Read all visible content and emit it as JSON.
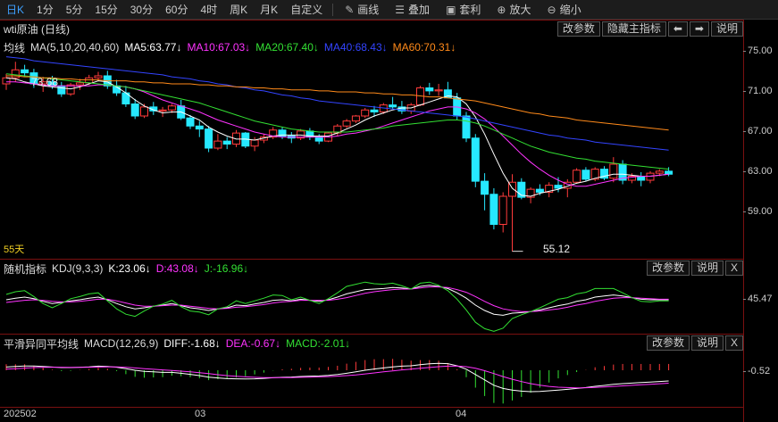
{
  "toolbar": {
    "timeframes": [
      "日K",
      "1分",
      "5分",
      "15分",
      "30分",
      "60分",
      "4时",
      "周K",
      "月K",
      "自定义"
    ],
    "tools": [
      {
        "icon": "pencil-icon",
        "glyph": "✎",
        "label": "画线"
      },
      {
        "icon": "layers-icon",
        "glyph": "☰",
        "label": "叠加"
      },
      {
        "icon": "bag-icon",
        "glyph": "▣",
        "label": "套利"
      },
      {
        "icon": "zoom-in-icon",
        "glyph": "⊕",
        "label": "放大"
      },
      {
        "icon": "zoom-out-icon",
        "glyph": "⊖",
        "label": "缩小"
      }
    ]
  },
  "main": {
    "title": "wti原油 (日线)",
    "buttons": {
      "params": "改参数",
      "hide": "隐藏主指标",
      "left_glyph": "⬅",
      "right_glyph": "➡",
      "help": "说明"
    },
    "ma_name": "均线",
    "ma_params": "MA(5,10,20,40,60)",
    "ma5": "MA5:63.77↓",
    "ma10": "MA10:67.03↓",
    "ma20": "MA20:67.40↓",
    "ma40": "MA40:68.43↓",
    "ma60": "MA60:70.31↓",
    "high_label": "73.68",
    "low_label": "55.12",
    "days_label": "55天",
    "y_ticks": [
      "75.00",
      "71.00",
      "67.00",
      "63.00",
      "59.00"
    ]
  },
  "kdj": {
    "name": "随机指标",
    "params": "KDJ(9,3,3)",
    "k": "K:23.06↓",
    "d": "D:43.08↓",
    "j": "J:-16.96↓",
    "buttons": {
      "params": "改参数",
      "help": "说明",
      "close": "X"
    },
    "y_tick": "45.47"
  },
  "macd": {
    "name": "平滑异同平均线",
    "params": "MACD(12,26,9)",
    "diff": "DIFF:-1.68↓",
    "dea": "DEA:-0.67↓",
    "macd": "MACD:-2.01↓",
    "buttons": {
      "params": "改参数",
      "help": "说明",
      "close": "X"
    },
    "y_tick": "-0.52"
  },
  "x_labels": [
    "202502",
    "03",
    "04"
  ],
  "colors": {
    "up": "#ff3b3b",
    "down": "#26e8ff",
    "ma5": "#ffffff",
    "ma10": "#ff33ff",
    "ma20": "#33e033",
    "ma40": "#3344ff",
    "ma60": "#ff8a1a",
    "accent": "#3ea0ff"
  },
  "candles": [
    [
      71.8,
      72.8,
      71.2,
      72.4
    ],
    [
      72.4,
      74.0,
      72.0,
      73.2
    ],
    [
      73.2,
      73.7,
      72.5,
      72.9
    ],
    [
      72.9,
      73.3,
      71.4,
      71.8
    ],
    [
      71.8,
      72.5,
      71.0,
      72.0
    ],
    [
      72.0,
      72.6,
      71.3,
      71.6
    ],
    [
      71.6,
      72.0,
      70.5,
      70.8
    ],
    [
      70.8,
      71.9,
      70.6,
      71.7
    ],
    [
      71.7,
      72.3,
      71.2,
      71.9
    ],
    [
      71.9,
      72.7,
      71.7,
      72.4
    ],
    [
      72.4,
      73.0,
      72.1,
      72.6
    ],
    [
      72.6,
      73.1,
      71.3,
      71.6
    ],
    [
      71.6,
      72.2,
      70.6,
      70.9
    ],
    [
      70.9,
      71.6,
      69.5,
      69.8
    ],
    [
      69.8,
      70.3,
      68.3,
      68.6
    ],
    [
      68.6,
      69.8,
      68.4,
      69.5
    ],
    [
      69.5,
      70.0,
      68.7,
      69.1
    ],
    [
      69.1,
      69.5,
      68.5,
      69.2
    ],
    [
      69.2,
      69.8,
      68.9,
      69.6
    ],
    [
      69.6,
      70.2,
      68.2,
      68.4
    ],
    [
      68.4,
      68.7,
      67.3,
      67.6
    ],
    [
      67.6,
      68.1,
      66.5,
      67.3
    ],
    [
      67.3,
      67.6,
      65.0,
      65.4
    ],
    [
      65.4,
      66.8,
      65.2,
      66.1
    ],
    [
      66.1,
      66.5,
      65.3,
      65.8
    ],
    [
      65.8,
      67.2,
      65.5,
      66.9
    ],
    [
      66.9,
      67.0,
      65.4,
      65.6
    ],
    [
      65.6,
      66.5,
      65.1,
      66.2
    ],
    [
      66.2,
      66.8,
      65.9,
      66.5
    ],
    [
      66.5,
      67.5,
      66.3,
      67.2
    ],
    [
      67.2,
      67.5,
      66.3,
      66.6
    ],
    [
      66.6,
      67.0,
      65.9,
      66.4
    ],
    [
      66.4,
      67.3,
      66.2,
      67.1
    ],
    [
      67.1,
      67.4,
      66.2,
      66.5
    ],
    [
      66.5,
      66.8,
      65.8,
      66.1
    ],
    [
      66.1,
      67.0,
      66.0,
      66.9
    ],
    [
      66.9,
      67.8,
      66.6,
      67.6
    ],
    [
      67.6,
      68.3,
      67.4,
      68.1
    ],
    [
      68.1,
      68.7,
      67.9,
      68.6
    ],
    [
      68.6,
      69.4,
      68.4,
      69.2
    ],
    [
      69.2,
      69.6,
      68.5,
      69.0
    ],
    [
      69.0,
      69.9,
      68.8,
      69.7
    ],
    [
      69.7,
      70.5,
      69.3,
      69.5
    ],
    [
      69.5,
      70.1,
      68.8,
      69.1
    ],
    [
      69.1,
      69.9,
      68.8,
      69.7
    ],
    [
      69.7,
      71.6,
      69.6,
      71.4
    ],
    [
      71.4,
      71.9,
      70.7,
      71.1
    ],
    [
      71.1,
      71.8,
      70.6,
      71.2
    ],
    [
      71.2,
      72.0,
      70.5,
      70.4
    ],
    [
      70.4,
      70.9,
      68.2,
      68.6
    ],
    [
      68.6,
      69.0,
      66.0,
      66.4
    ],
    [
      66.4,
      66.8,
      61.5,
      62.1
    ],
    [
      62.1,
      62.9,
      59.2,
      60.8
    ],
    [
      60.8,
      61.4,
      57.3,
      57.8
    ],
    [
      57.8,
      61.0,
      57.0,
      60.6
    ],
    [
      60.6,
      62.8,
      55.1,
      62.0
    ],
    [
      62.0,
      62.4,
      60.3,
      60.5
    ],
    [
      60.5,
      61.5,
      59.9,
      61.3
    ],
    [
      61.3,
      61.8,
      60.7,
      61.0
    ],
    [
      61.0,
      62.0,
      60.5,
      61.7
    ],
    [
      61.7,
      62.5,
      61.0,
      61.4
    ],
    [
      61.4,
      62.3,
      60.5,
      62.0
    ],
    [
      62.0,
      63.4,
      61.9,
      63.2
    ],
    [
      63.2,
      63.5,
      62.1,
      62.3
    ],
    [
      62.3,
      63.5,
      62.1,
      63.3
    ],
    [
      63.3,
      63.6,
      62.2,
      62.4
    ],
    [
      62.4,
      64.5,
      62.0,
      63.8
    ],
    [
      63.8,
      64.2,
      61.8,
      62.2
    ],
    [
      62.2,
      62.9,
      61.9,
      62.6
    ],
    [
      62.6,
      63.0,
      61.6,
      62.2
    ],
    [
      62.2,
      63.1,
      61.9,
      62.9
    ],
    [
      62.9,
      63.3,
      62.6,
      63.1
    ],
    [
      63.1,
      63.5,
      62.6,
      62.8
    ]
  ],
  "ma_lines": {
    "ma5": [
      72.4,
      72.3,
      72.0,
      71.8,
      71.6,
      71.5,
      71.4,
      71.3,
      71.5,
      71.8,
      72.1,
      72.0,
      71.5,
      70.9,
      70.2,
      69.6,
      69.2,
      68.9,
      69.0,
      69.0,
      68.6,
      68.2,
      67.5,
      67.0,
      66.6,
      66.3,
      66.3,
      66.2,
      66.4,
      66.6,
      66.7,
      66.7,
      66.7,
      66.6,
      66.6,
      66.6,
      66.9,
      67.3,
      67.7,
      68.2,
      68.6,
      68.9,
      69.2,
      69.4,
      69.4,
      69.7,
      70.0,
      70.3,
      70.6,
      70.5,
      69.8,
      68.5,
      66.8,
      64.8,
      62.9,
      61.4,
      60.7,
      60.6,
      60.9,
      61.1,
      61.3,
      61.6,
      61.9,
      62.1,
      62.4,
      62.6,
      62.8,
      62.8,
      62.7,
      62.6,
      62.6,
      62.7,
      62.8
    ],
    "ma10": [
      72.0,
      72.0,
      71.9,
      71.8,
      71.7,
      71.6,
      71.6,
      71.6,
      71.6,
      71.6,
      71.7,
      71.7,
      71.6,
      71.5,
      71.3,
      71.0,
      70.6,
      70.2,
      69.9,
      69.6,
      69.3,
      69.0,
      68.6,
      68.2,
      67.9,
      67.6,
      67.3,
      67.0,
      66.8,
      66.6,
      66.5,
      66.5,
      66.5,
      66.5,
      66.5,
      66.5,
      66.6,
      66.8,
      66.9,
      67.1,
      67.3,
      67.6,
      67.9,
      68.2,
      68.5,
      68.8,
      69.1,
      69.3,
      69.5,
      69.5,
      69.3,
      68.9,
      68.3,
      67.5,
      66.6,
      65.7,
      64.8,
      64.0,
      63.3,
      62.7,
      62.2,
      61.8,
      61.6,
      61.6,
      61.8,
      62.0,
      62.2,
      62.4,
      62.5,
      62.6,
      62.6,
      62.7,
      62.8
    ],
    "ma20": [
      72.8,
      72.7,
      72.6,
      72.5,
      72.4,
      72.3,
      72.2,
      72.1,
      72.0,
      71.9,
      71.8,
      71.7,
      71.6,
      71.5,
      71.3,
      71.1,
      70.9,
      70.7,
      70.5,
      70.3,
      70.1,
      69.9,
      69.6,
      69.3,
      69.0,
      68.7,
      68.4,
      68.1,
      67.9,
      67.7,
      67.5,
      67.3,
      67.2,
      67.1,
      67.0,
      67.0,
      67.0,
      67.0,
      67.1,
      67.2,
      67.3,
      67.4,
      67.6,
      67.7,
      67.8,
      67.9,
      68.0,
      68.1,
      68.2,
      68.2,
      68.1,
      67.9,
      67.6,
      67.2,
      66.8,
      66.4,
      66.0,
      65.6,
      65.3,
      65.0,
      64.8,
      64.6,
      64.4,
      64.3,
      64.1,
      64.0,
      63.9,
      63.8,
      63.7,
      63.6,
      63.5,
      63.4,
      63.3
    ],
    "ma40": [
      74.5,
      74.4,
      74.3,
      74.1,
      74.0,
      73.9,
      73.8,
      73.7,
      73.6,
      73.5,
      73.4,
      73.3,
      73.2,
      73.1,
      73.0,
      72.9,
      72.8,
      72.7,
      72.5,
      72.4,
      72.3,
      72.1,
      72.0,
      71.8,
      71.7,
      71.5,
      71.4,
      71.2,
      71.1,
      70.9,
      70.7,
      70.6,
      70.4,
      70.3,
      70.1,
      70.0,
      69.9,
      69.8,
      69.7,
      69.6,
      69.5,
      69.4,
      69.3,
      69.2,
      69.1,
      69.0,
      68.9,
      68.8,
      68.7,
      68.6,
      68.5,
      68.3,
      68.1,
      67.9,
      67.7,
      67.5,
      67.3,
      67.1,
      66.9,
      66.7,
      66.6,
      66.4,
      66.3,
      66.2,
      66.0,
      65.9,
      65.8,
      65.7,
      65.6,
      65.5,
      65.4,
      65.3,
      65.2
    ],
    "ma60": [
      72.6,
      72.6,
      72.5,
      72.5,
      72.4,
      72.4,
      72.3,
      72.3,
      72.2,
      72.2,
      72.2,
      72.1,
      72.1,
      72.1,
      72.0,
      72.0,
      71.9,
      71.9,
      71.8,
      71.8,
      71.8,
      71.7,
      71.7,
      71.6,
      71.6,
      71.5,
      71.5,
      71.4,
      71.4,
      71.3,
      71.3,
      71.2,
      71.2,
      71.2,
      71.1,
      71.1,
      71.0,
      71.0,
      71.0,
      70.9,
      70.9,
      70.8,
      70.8,
      70.7,
      70.7,
      70.6,
      70.5,
      70.5,
      70.4,
      70.3,
      70.2,
      70.1,
      69.9,
      69.7,
      69.5,
      69.3,
      69.1,
      68.9,
      68.8,
      68.6,
      68.5,
      68.4,
      68.2,
      68.1,
      68.0,
      67.9,
      67.8,
      67.7,
      67.6,
      67.5,
      67.4,
      67.3,
      67.2
    ]
  },
  "kdj_lines": {
    "k": [
      55,
      58,
      60,
      57,
      52,
      48,
      50,
      53,
      55,
      58,
      60,
      55,
      48,
      42,
      38,
      40,
      43,
      45,
      48,
      44,
      40,
      38,
      35,
      38,
      40,
      45,
      44,
      47,
      50,
      54,
      55,
      53,
      56,
      54,
      52,
      55,
      60,
      66,
      70,
      74,
      75,
      76,
      78,
      77,
      75,
      80,
      82,
      80,
      76,
      68,
      58,
      45,
      35,
      28,
      26,
      30,
      31,
      33,
      36,
      40,
      44,
      47,
      52,
      55,
      60,
      62,
      64,
      62,
      59,
      56,
      55,
      55,
      55
    ],
    "d": [
      50,
      52,
      54,
      55,
      54,
      52,
      51,
      51,
      52,
      54,
      56,
      56,
      53,
      49,
      45,
      43,
      43,
      44,
      45,
      45,
      43,
      41,
      39,
      38,
      39,
      41,
      42,
      44,
      46,
      49,
      51,
      52,
      54,
      54,
      54,
      54,
      56,
      59,
      63,
      67,
      70,
      72,
      74,
      75,
      75,
      77,
      79,
      79,
      78,
      74,
      69,
      61,
      52,
      44,
      38,
      35,
      33,
      33,
      34,
      36,
      38,
      41,
      45,
      48,
      52,
      55,
      58,
      59,
      59,
      58,
      57,
      56,
      56
    ],
    "j": [
      65,
      70,
      72,
      61,
      48,
      40,
      48,
      57,
      61,
      66,
      68,
      53,
      38,
      28,
      24,
      34,
      43,
      47,
      54,
      42,
      34,
      32,
      27,
      38,
      42,
      53,
      48,
      53,
      58,
      64,
      63,
      55,
      60,
      54,
      48,
      57,
      68,
      80,
      84,
      88,
      85,
      84,
      86,
      81,
      75,
      86,
      88,
      82,
      72,
      56,
      36,
      13,
      1,
      -4,
      2,
      20,
      27,
      33,
      40,
      48,
      56,
      59,
      66,
      69,
      76,
      76,
      76,
      68,
      59,
      52,
      51,
      53,
      53
    ]
  },
  "macd_lines": {
    "diff": [
      0.3,
      0.35,
      0.4,
      0.4,
      0.35,
      0.3,
      0.25,
      0.25,
      0.28,
      0.32,
      0.38,
      0.36,
      0.28,
      0.15,
      0.0,
      -0.1,
      -0.15,
      -0.2,
      -0.2,
      -0.28,
      -0.38,
      -0.5,
      -0.65,
      -0.72,
      -0.78,
      -0.8,
      -0.82,
      -0.8,
      -0.76,
      -0.7,
      -0.66,
      -0.63,
      -0.58,
      -0.55,
      -0.53,
      -0.48,
      -0.4,
      -0.28,
      -0.15,
      0.0,
      0.12,
      0.22,
      0.32,
      0.38,
      0.42,
      0.52,
      0.6,
      0.65,
      0.62,
      0.42,
      0.1,
      -0.4,
      -0.9,
      -1.4,
      -1.7,
      -1.85,
      -1.95,
      -2.0,
      -1.98,
      -1.92,
      -1.85,
      -1.78,
      -1.7,
      -1.62,
      -1.5,
      -1.42,
      -1.32,
      -1.25,
      -1.2,
      -1.15,
      -1.1,
      -1.05,
      -1.0
    ],
    "dea": [
      0.1,
      0.15,
      0.2,
      0.25,
      0.27,
      0.28,
      0.28,
      0.27,
      0.27,
      0.28,
      0.3,
      0.31,
      0.31,
      0.28,
      0.22,
      0.15,
      0.09,
      0.03,
      -0.02,
      -0.08,
      -0.15,
      -0.23,
      -0.32,
      -0.42,
      -0.5,
      -0.56,
      -0.62,
      -0.66,
      -0.68,
      -0.69,
      -0.69,
      -0.68,
      -0.66,
      -0.64,
      -0.62,
      -0.59,
      -0.55,
      -0.5,
      -0.43,
      -0.34,
      -0.25,
      -0.15,
      -0.06,
      0.03,
      0.1,
      0.18,
      0.26,
      0.33,
      0.38,
      0.39,
      0.33,
      0.18,
      -0.04,
      -0.31,
      -0.59,
      -0.84,
      -1.06,
      -1.25,
      -1.4,
      -1.51,
      -1.58,
      -1.62,
      -1.64,
      -1.63,
      -1.6,
      -1.56,
      -1.51,
      -1.46,
      -1.41,
      -1.36,
      -1.31,
      -1.26,
      -1.21
    ]
  }
}
